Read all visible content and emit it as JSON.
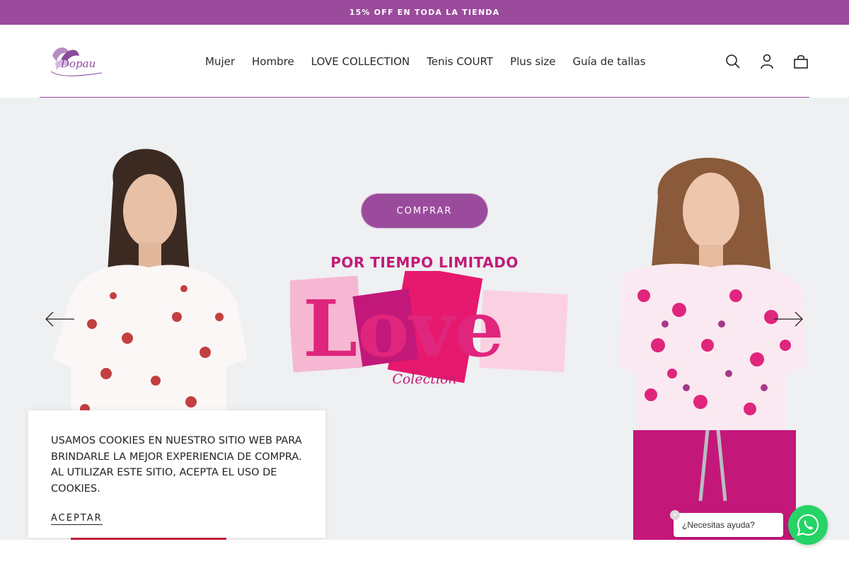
{
  "announcement": {
    "text": "15% OFF EN TODA LA TIENDA"
  },
  "header": {
    "logo_text": "Dopau",
    "nav": [
      {
        "label": "Mujer"
      },
      {
        "label": "Hombre"
      },
      {
        "label": "LOVE COLLECTION"
      },
      {
        "label": "Tenis COURT"
      },
      {
        "label": "Plus size"
      },
      {
        "label": "Guía de tallas"
      }
    ],
    "icons": [
      "search-icon",
      "account-icon",
      "cart-icon"
    ]
  },
  "hero": {
    "kicker": "POR TIEMPO LIMITADO",
    "love_word": "Love",
    "collection_word": "Colection",
    "button_label": "COMPRAR"
  },
  "cookie": {
    "text": "USAMOS COOKIES EN NUESTRO SITIO WEB PARA BRINDARLE LA MEJOR EXPERIENCIA DE COMPRA. AL UTILIZAR ESTE SITIO, ACEPTA EL USO DE COOKIES.",
    "accept_label": "ACEPTAR"
  },
  "chat": {
    "bubble_text": "¿Necesitas ayuda?",
    "close_symbol": "×"
  },
  "colors": {
    "brand_purple": "#9b4b9c",
    "hero_pink": "#c21a78",
    "whatsapp_green": "#25d366"
  }
}
